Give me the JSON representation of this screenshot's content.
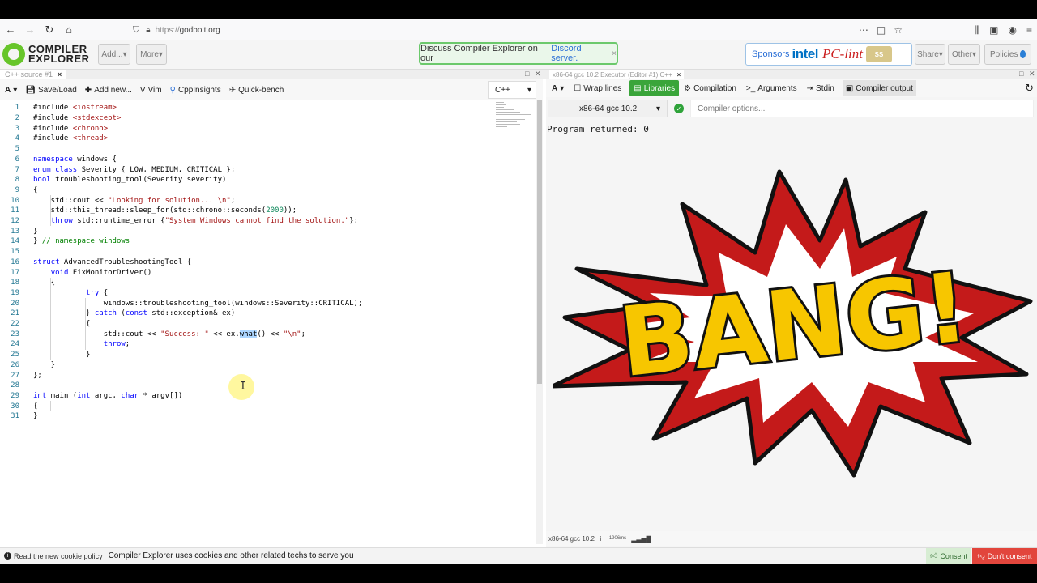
{
  "browser": {
    "url_scheme": "https://",
    "url_host": "godbolt.org",
    "icons": [
      "back-icon",
      "forward-icon",
      "reload-icon",
      "home-icon",
      "shield-icon",
      "lock-icon",
      "more-icon",
      "pocket-icon",
      "star-icon",
      "library-icon",
      "sidebar-icon",
      "account-icon",
      "menu-icon"
    ]
  },
  "header": {
    "logo_line1": "COMPILER",
    "logo_line2": "EXPLORER",
    "add_label": "Add...",
    "more_label": "More",
    "discord_text": "Discuss Compiler Explorer on our",
    "discord_link": "Discord server.",
    "discord_close": "×",
    "sponsors_label": "Sponsors",
    "sponsor_intel": "intel",
    "sponsor_pclint": "PC-lint",
    "sponsor_solid": "Solid Sands",
    "share_label": "Share",
    "other_label": "Other",
    "policies_label": "Policies"
  },
  "source_pane": {
    "tab_title": "C++ source #1",
    "toolbar": {
      "font_label": "A",
      "save_load": "Save/Load",
      "add_new": "Add new...",
      "vim": "Vim",
      "cppinsights": "CppInsights",
      "quickbench": "Quick-bench",
      "language": "C++"
    },
    "lines": [
      {
        "n": "1",
        "html": "#include <span class='str'>&lt;iostream&gt;</span>",
        "indent": 0
      },
      {
        "n": "2",
        "html": "#include <span class='str'>&lt;stdexcept&gt;</span>",
        "indent": 0
      },
      {
        "n": "3",
        "html": "#include <span class='str'>&lt;chrono&gt;</span>",
        "indent": 0
      },
      {
        "n": "4",
        "html": "#include <span class='str'>&lt;thread&gt;</span>",
        "indent": 0
      },
      {
        "n": "5",
        "html": "",
        "indent": 0
      },
      {
        "n": "6",
        "html": "<span class='kw'>namespace</span> windows {",
        "indent": 0
      },
      {
        "n": "7",
        "html": "<span class='kw'>enum class</span> Severity { LOW, MEDIUM, CRITICAL };",
        "indent": 0
      },
      {
        "n": "8",
        "html": "<span class='kw'>bool</span> troubleshooting_tool(Severity severity)",
        "indent": 0
      },
      {
        "n": "9",
        "html": "{",
        "indent": 0
      },
      {
        "n": "10",
        "html": "    std::cout &lt;&lt; <span class='str'>\"Looking for solution... \\n\"</span>;",
        "indent": 0
      },
      {
        "n": "11",
        "html": "    std::this_thread::sleep_for(std::chrono::seconds(<span class='num'>2000</span>));",
        "indent": 0
      },
      {
        "n": "12",
        "html": "    <span class='kw'>throw</span> std::runtime_error {<span class='str'>\"System Windows cannot find the solution.\"</span>};",
        "indent": 0
      },
      {
        "n": "13",
        "html": "}",
        "indent": 0
      },
      {
        "n": "14",
        "html": "} <span class='cmt'>// namespace windows</span>",
        "indent": 0
      },
      {
        "n": "15",
        "html": "",
        "indent": 0
      },
      {
        "n": "16",
        "html": "<span class='kw'>struct</span> AdvancedTroubleshootingTool {",
        "indent": 0
      },
      {
        "n": "17",
        "html": "    <span class='kw'>void</span> FixMonitorDriver()",
        "indent": 0
      },
      {
        "n": "18",
        "html": "    {",
        "indent": 0
      },
      {
        "n": "19",
        "html": "            <span class='kw'>try</span> {",
        "indent": 0
      },
      {
        "n": "20",
        "html": "                windows::troubleshooting_tool(windows::Severity::CRITICAL);",
        "indent": 0
      },
      {
        "n": "21",
        "html": "            } <span class='kw'>catch</span> (<span class='kw'>const</span> std::exception&amp; ex)",
        "indent": 0
      },
      {
        "n": "22",
        "html": "            {",
        "indent": 0
      },
      {
        "n": "23",
        "html": "                std::cout &lt;&lt; <span class='str'>\"Success: \"</span> &lt;&lt; ex.<span class='hl'>what</span>() &lt;&lt; <span class='str'>\"\\n\"</span>;",
        "indent": 0
      },
      {
        "n": "24",
        "html": "                <span class='kw'>throw</span>;",
        "indent": 0
      },
      {
        "n": "25",
        "html": "            }",
        "indent": 0
      },
      {
        "n": "26",
        "html": "    }",
        "indent": 0
      },
      {
        "n": "27",
        "html": "};",
        "indent": 0
      },
      {
        "n": "28",
        "html": "",
        "indent": 0
      },
      {
        "n": "29",
        "html": "<span class='kw'>int</span> main (<span class='kw'>int</span> argc, <span class='kw'>char</span> * argv[])",
        "indent": 0
      },
      {
        "n": "30",
        "html": "{",
        "indent": 0
      },
      {
        "n": "31",
        "html": "}",
        "indent": 0
      }
    ]
  },
  "executor_pane": {
    "tab_title": "x86-64 gcc 10.2 Executor (Editor #1) C++",
    "toolbar": {
      "font_label": "A",
      "wrap_lines": "Wrap lines",
      "libraries": "Libraries",
      "compilation": "Compilation",
      "arguments": "Arguments",
      "stdin": "Stdin",
      "compiler_output": "Compiler output"
    },
    "compiler": "x86-64 gcc 10.2",
    "compiler_options_placeholder": "Compiler options...",
    "program_returned": "Program returned: 0",
    "bang_text": "BANG!",
    "status_compiler": "x86-64 gcc 10.2",
    "status_time": "- 1906ms",
    "colors": {
      "bang_yellow": "#f7c600",
      "bang_red": "#c41a1a",
      "libraries_green": "#3aa53a"
    }
  },
  "footer": {
    "cookie_link": "Read the new cookie policy",
    "cookie_text": "Compiler Explorer uses cookies and other related techs to serve you",
    "consent": "Consent",
    "dont_consent": "Don't consent"
  }
}
